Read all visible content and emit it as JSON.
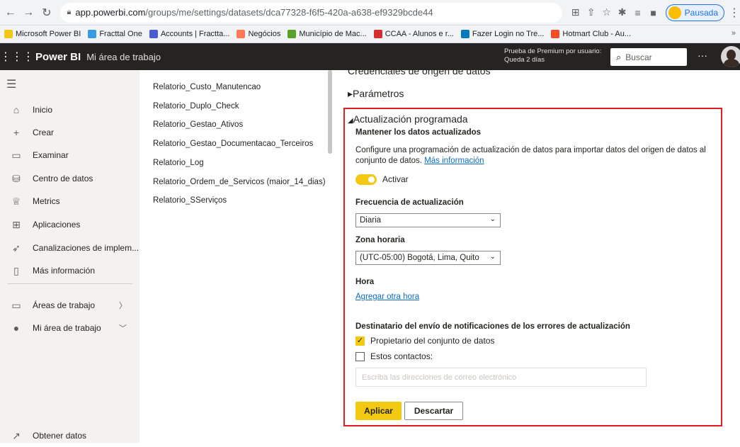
{
  "browser": {
    "url_host": "app.powerbi.com",
    "url_path": "/groups/me/settings/datasets/dca77328-f6f5-420a-a638-ef9329bcde44",
    "profile_label": "Pausada",
    "bookmarks": [
      {
        "label": "Microsoft Power BI",
        "color": "#f2c811"
      },
      {
        "label": "Fracttal One",
        "color": "#3b9be0"
      },
      {
        "label": "Accounts | Fractta...",
        "color": "#4a5bd4"
      },
      {
        "label": "Negócios",
        "color": "#ff7a59"
      },
      {
        "label": "Município de Mac...",
        "color": "#5aa02c"
      },
      {
        "label": "CCAA - Alunos e r...",
        "color": "#d32f2f"
      },
      {
        "label": "Fazer Login no Tre...",
        "color": "#0079bf"
      },
      {
        "label": "Hotmart Club - Au...",
        "color": "#f04e23"
      }
    ],
    "bookmarks_more": "»"
  },
  "header": {
    "brand": "Power BI",
    "workspace": "Mi área de trabajo",
    "premium_line1": "Prueba de Premium por usuario:",
    "premium_line2": "Queda 2 días",
    "search_placeholder": "Buscar",
    "more": "···"
  },
  "leftnav": {
    "items": [
      {
        "label": "Inicio",
        "icon": "home-icon"
      },
      {
        "label": "Crear",
        "icon": "plus-icon"
      },
      {
        "label": "Examinar",
        "icon": "folder-icon"
      },
      {
        "label": "Centro de datos",
        "icon": "database-icon"
      },
      {
        "label": "Metrics",
        "icon": "trophy-icon"
      },
      {
        "label": "Aplicaciones",
        "icon": "apps-icon"
      },
      {
        "label": "Canalizaciones de implem...",
        "icon": "rocket-icon"
      },
      {
        "label": "Más información",
        "icon": "book-icon"
      }
    ],
    "workspaces_label": "Áreas de trabajo",
    "my_workspace_label": "Mi área de trabajo",
    "get_data_label": "Obtener datos"
  },
  "datasets": [
    "Relatorio_Custo_Manutencao",
    "Relatorio_Duplo_Check",
    "Relatorio_Gestao_Ativos",
    "Relatorio_Gestao_Documentacao_Terceiros",
    "Relatorio_Log",
    "Relatorio_Ordem_de_Servicos (maior_14_dias)",
    "Relatorio_SServiços"
  ],
  "settings": {
    "cut_section_title": "Credenciales de origen de datos",
    "parameters_title": "Parámetros",
    "refresh_title": "Actualización programada",
    "keep_updated_label": "Mantener los datos actualizados",
    "description": "Configure una programación de actualización de datos para importar datos del origen de datos al conjunto de datos.",
    "more_info_link": "Más información",
    "toggle_label": "Activar",
    "toggle_on": true,
    "frequency_label": "Frecuencia de actualización",
    "frequency_value": "Diaria",
    "timezone_label": "Zona horaria",
    "timezone_value": "(UTC-05:00) Bogotá, Lima, Quito",
    "time_label": "Hora",
    "add_time_link": "Agregar otra hora",
    "notify_label": "Destinatario del envío de notificaciones de los errores de actualización",
    "owner_label": "Propietario del conjunto de datos",
    "owner_checked": true,
    "contacts_label": "Estos contactos:",
    "contacts_checked": false,
    "email_placeholder": "Escriba las direcciones de correo electrónico",
    "apply_label": "Aplicar",
    "discard_label": "Descartar"
  },
  "colors": {
    "accent": "#f2c811",
    "highlight_frame": "#e02020",
    "link": "#0f6cbd"
  }
}
